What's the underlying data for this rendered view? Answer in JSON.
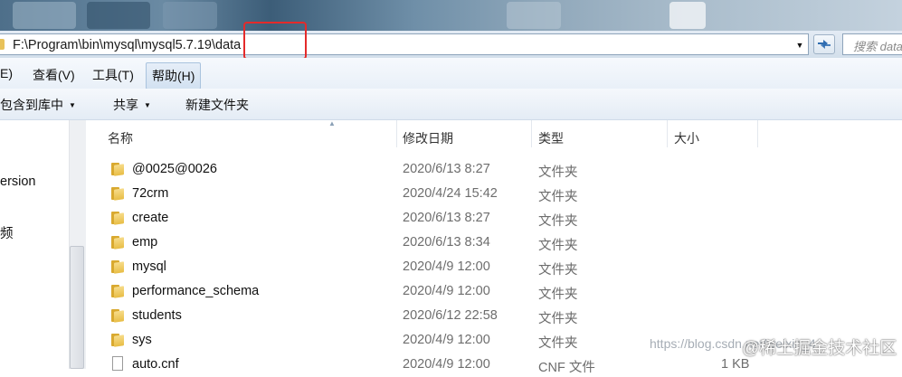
{
  "address_bar": {
    "path": "F:\\Program\\bin\\mysql\\mysql5.7.19\\data",
    "search_placeholder": "搜索 data"
  },
  "menu": {
    "items": [
      {
        "label": "E)"
      },
      {
        "label": "查看(V)"
      },
      {
        "label": "工具(T)"
      },
      {
        "label": "帮助(H)"
      }
    ]
  },
  "toolbar": {
    "include_library": "包含到库中",
    "share": "共享",
    "new_folder": "新建文件夹"
  },
  "nav": {
    "items": [
      {
        "label": "ersion"
      },
      {
        "label": "频"
      }
    ]
  },
  "columns": {
    "name": "名称",
    "date": "修改日期",
    "type": "类型",
    "size": "大小"
  },
  "files": [
    {
      "name": "@0025@0026",
      "date": "2020/6/13 8:27",
      "type": "文件夹",
      "size": "",
      "icon": "folder-icon"
    },
    {
      "name": "72crm",
      "date": "2020/4/24 15:42",
      "type": "文件夹",
      "size": "",
      "icon": "folder-icon"
    },
    {
      "name": "create",
      "date": "2020/6/13 8:27",
      "type": "文件夹",
      "size": "",
      "icon": "folder-icon"
    },
    {
      "name": "emp",
      "date": "2020/6/13 8:34",
      "type": "文件夹",
      "size": "",
      "icon": "folder-icon"
    },
    {
      "name": "mysql",
      "date": "2020/4/9 12:00",
      "type": "文件夹",
      "size": "",
      "icon": "folder-icon"
    },
    {
      "name": "performance_schema",
      "date": "2020/4/9 12:00",
      "type": "文件夹",
      "size": "",
      "icon": "folder-icon"
    },
    {
      "name": "students",
      "date": "2020/6/12 22:58",
      "type": "文件夹",
      "size": "",
      "icon": "folder-icon"
    },
    {
      "name": "sys",
      "date": "2020/4/9 12:00",
      "type": "文件夹",
      "size": "",
      "icon": "folder-icon"
    },
    {
      "name": "auto.cnf",
      "date": "2020/4/9 12:00",
      "type": "CNF 文件",
      "size": "1 KB",
      "icon": "file-icon"
    }
  ],
  "watermark": {
    "url": "https://blog.csdn.net/weixin_4",
    "brand": "@稀土掘金技术社区"
  },
  "colors": {
    "highlight_box": "#e42a2a",
    "folder": "#e8bd45"
  }
}
